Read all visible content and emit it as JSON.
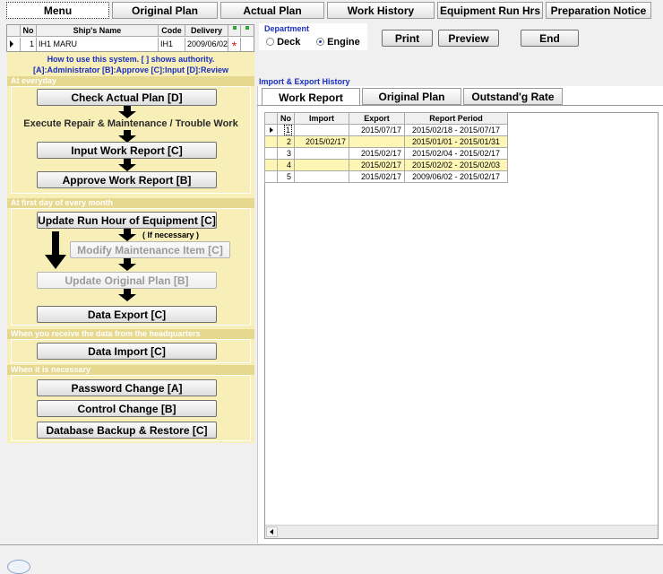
{
  "tabs": [
    "Menu",
    "Original Plan",
    "Actual Plan",
    "Work History",
    "Equipment Run Hrs",
    "Preparation Notice"
  ],
  "ship_table": {
    "headers": [
      "No",
      "Ship's Name",
      "Code",
      "Delivery"
    ],
    "row": {
      "no": "1",
      "name": "IH1 MARU",
      "code": "IH1",
      "delivery": "2009/06/02",
      "marker": "*"
    }
  },
  "help": {
    "line1": "How to use this system.  [ ] shows authority.",
    "line2": "[A]:Administrator  [B]:Approve  [C]:Input  [D]:Review"
  },
  "sections": {
    "everyday": "At everyday",
    "first_day": "At first day of every month",
    "receive": "When you receive the data from the headquarters",
    "necessary": "When it is necessary"
  },
  "buttons": {
    "check_actual": "Check Actual Plan  [D]",
    "input_work": "Input Work Report  [C]",
    "approve_work": "Approve Work Report  [B]",
    "update_run": "Update Run Hour of Equipment  [C]",
    "modify_maint": "Modify Maintenance Item  [C]",
    "update_orig": "Update Original Plan  [B]",
    "data_export": "Data Export  [C]",
    "data_import": "Data Import  [C]",
    "password": "Password Change  [A]",
    "control": "Control Change  [B]",
    "backup": "Database Backup & Restore  [C]"
  },
  "texts": {
    "execute": "Execute Repair & Maintenance / Trouble Work",
    "if_necessary": "( If necessary )"
  },
  "department": {
    "label": "Department",
    "options": [
      "Deck",
      "Engine"
    ],
    "selected": "Engine"
  },
  "top_buttons": {
    "print": "Print",
    "preview": "Preview",
    "end": "End"
  },
  "history": {
    "title": "Import & Export History",
    "tabs": [
      "Work Report",
      "Original Plan",
      "Outstand'g Rate"
    ],
    "headers": [
      "No",
      "Import",
      "Export",
      "Report Period"
    ],
    "rows": [
      {
        "no": "1",
        "import": "",
        "export": "2015/07/17",
        "period": "2015/02/18 - 2015/07/17"
      },
      {
        "no": "2",
        "import": "2015/02/17",
        "export": "",
        "period": "2015/01/01 - 2015/01/31"
      },
      {
        "no": "3",
        "import": "",
        "export": "2015/02/17",
        "period": "2015/02/04 - 2015/02/17"
      },
      {
        "no": "4",
        "import": "",
        "export": "2015/02/17",
        "period": "2015/02/02 - 2015/02/03"
      },
      {
        "no": "5",
        "import": "",
        "export": "2015/02/17",
        "period": "2009/06/02 - 2015/02/17"
      }
    ]
  }
}
